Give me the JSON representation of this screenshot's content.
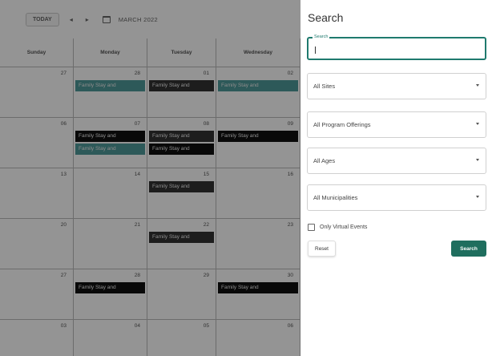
{
  "calendar": {
    "toolbar": {
      "today_label": "TODAY",
      "prev_icon": "chevron-left-icon",
      "next_icon": "chevron-right-icon",
      "calendar_icon": "calendar-icon",
      "month_label": "MARCH 2022"
    },
    "weekdays": [
      "Sunday",
      "Monday",
      "Tuesday",
      "Wednesday"
    ],
    "weeks": [
      [
        {
          "day": "27",
          "events": []
        },
        {
          "day": "28",
          "events": [
            {
              "label": "Family Stay and",
              "color": "teal"
            }
          ]
        },
        {
          "day": "01",
          "events": [
            {
              "label": "Family Stay and",
              "color": "dark"
            }
          ]
        },
        {
          "day": "02",
          "events": [
            {
              "label": "Family Stay and",
              "color": "teal"
            }
          ]
        }
      ],
      [
        {
          "day": "06",
          "events": []
        },
        {
          "day": "07",
          "events": [
            {
              "label": "Family Stay and",
              "color": "black"
            },
            {
              "label": "Family Stay and",
              "color": "teal"
            }
          ]
        },
        {
          "day": "08",
          "events": [
            {
              "label": "Family Stay and",
              "color": "dark"
            },
            {
              "label": "Family Stay and",
              "color": "black"
            }
          ]
        },
        {
          "day": "09",
          "events": [
            {
              "label": "Family Stay and",
              "color": "black"
            }
          ]
        }
      ],
      [
        {
          "day": "13",
          "events": []
        },
        {
          "day": "14",
          "events": []
        },
        {
          "day": "15",
          "events": [
            {
              "label": "Family Stay and",
              "color": "dark"
            }
          ]
        },
        {
          "day": "16",
          "events": []
        }
      ],
      [
        {
          "day": "20",
          "events": []
        },
        {
          "day": "21",
          "events": []
        },
        {
          "day": "22",
          "events": [
            {
              "label": "Family Stay and",
              "color": "dark"
            }
          ]
        },
        {
          "day": "23",
          "events": []
        }
      ],
      [
        {
          "day": "27",
          "events": []
        },
        {
          "day": "28",
          "events": [
            {
              "label": "Family Stay and",
              "color": "black"
            }
          ]
        },
        {
          "day": "29",
          "events": []
        },
        {
          "day": "30",
          "events": [
            {
              "label": "Family Stay and",
              "color": "black"
            }
          ]
        }
      ],
      [
        {
          "day": "03",
          "events": []
        },
        {
          "day": "04",
          "events": []
        },
        {
          "day": "05",
          "events": []
        },
        {
          "day": "06",
          "events": []
        }
      ]
    ]
  },
  "search_panel": {
    "title": "Search",
    "search_field": {
      "legend": "Search",
      "value": "",
      "placeholder": ""
    },
    "filters": [
      {
        "label": "All Sites"
      },
      {
        "label": "All Program Offerings"
      },
      {
        "label": "All Ages"
      },
      {
        "label": "All Municipalities"
      }
    ],
    "virtual_checkbox": {
      "label": "Only Virtual Events",
      "checked": false
    },
    "reset_label": "Reset",
    "search_label": "Search"
  },
  "colors": {
    "accent": "#1f7a6e",
    "search_button": "#1f6e5e",
    "event_teal": "#4f9a9a",
    "event_dark": "#333333",
    "event_black": "#111111"
  }
}
